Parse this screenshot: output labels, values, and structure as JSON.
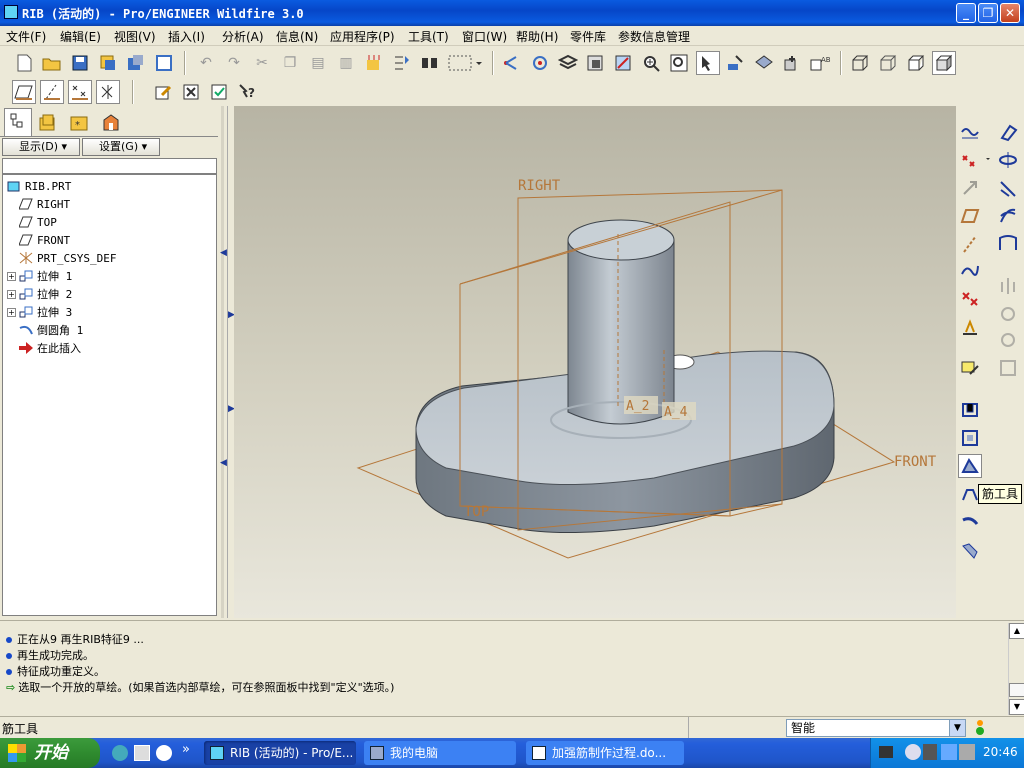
{
  "window": {
    "title": "RIB (活动的) - Pro/ENGINEER Wildfire 3.0"
  },
  "menu": [
    "文件(F)",
    "编辑(E)",
    "视图(V)",
    "插入(I)",
    "分析(A)",
    "信息(N)",
    "应用程序(P)",
    "工具(T)",
    "窗口(W)",
    "帮助(H)",
    "零件库",
    "参数信息管理"
  ],
  "navigator": {
    "show_label": "显示(D)",
    "settings_label": "设置(G)"
  },
  "model_tree": [
    {
      "label": "RIB.PRT",
      "icon": "part-icon",
      "expandable": false
    },
    {
      "label": "RIGHT",
      "icon": "datum-plane-icon",
      "expandable": false
    },
    {
      "label": "TOP",
      "icon": "datum-plane-icon",
      "expandable": false
    },
    {
      "label": "FRONT",
      "icon": "datum-plane-icon",
      "expandable": false
    },
    {
      "label": "PRT_CSYS_DEF",
      "icon": "csys-icon",
      "expandable": false
    },
    {
      "label": "拉伸 1",
      "icon": "extrude-icon",
      "expandable": true
    },
    {
      "label": "拉伸 2",
      "icon": "extrude-icon",
      "expandable": true
    },
    {
      "label": "拉伸 3",
      "icon": "extrude-icon",
      "expandable": true
    },
    {
      "label": "倒圆角 1",
      "icon": "round-icon",
      "expandable": false
    },
    {
      "label": "在此插入",
      "icon": "insert-here-arrow-icon",
      "expandable": false
    }
  ],
  "viewport": {
    "datum_labels": {
      "right": "RIGHT",
      "top": "TOP",
      "front": "FRONT",
      "axis_a2": "A_2",
      "axis_a4": "A_4"
    },
    "tooltip": "筋工具",
    "colors": {
      "datum": "#b5773a",
      "model": "#9aa3ad"
    }
  },
  "messages": [
    {
      "text": "正在从9 再生RIB特征9 ...",
      "type": "info"
    },
    {
      "text": "再生成功完成。",
      "type": "info"
    },
    {
      "text": "特征成功重定义。",
      "type": "info"
    },
    {
      "text": "选取一个开放的草绘。(如果首选内部草绘，可在参照面板中找到\"定义\"选项。)",
      "type": "prompt"
    }
  ],
  "status": {
    "left_text": "筋工具",
    "filter_value": "智能"
  },
  "taskbar": {
    "start_label": "开始",
    "tasks": [
      {
        "label": "RIB (活动的) - Pro/E...",
        "active": true
      },
      {
        "label": "我的电脑",
        "active": false
      },
      {
        "label": "加强筋制作过程.do...",
        "active": false
      }
    ],
    "clock": "20:46"
  }
}
